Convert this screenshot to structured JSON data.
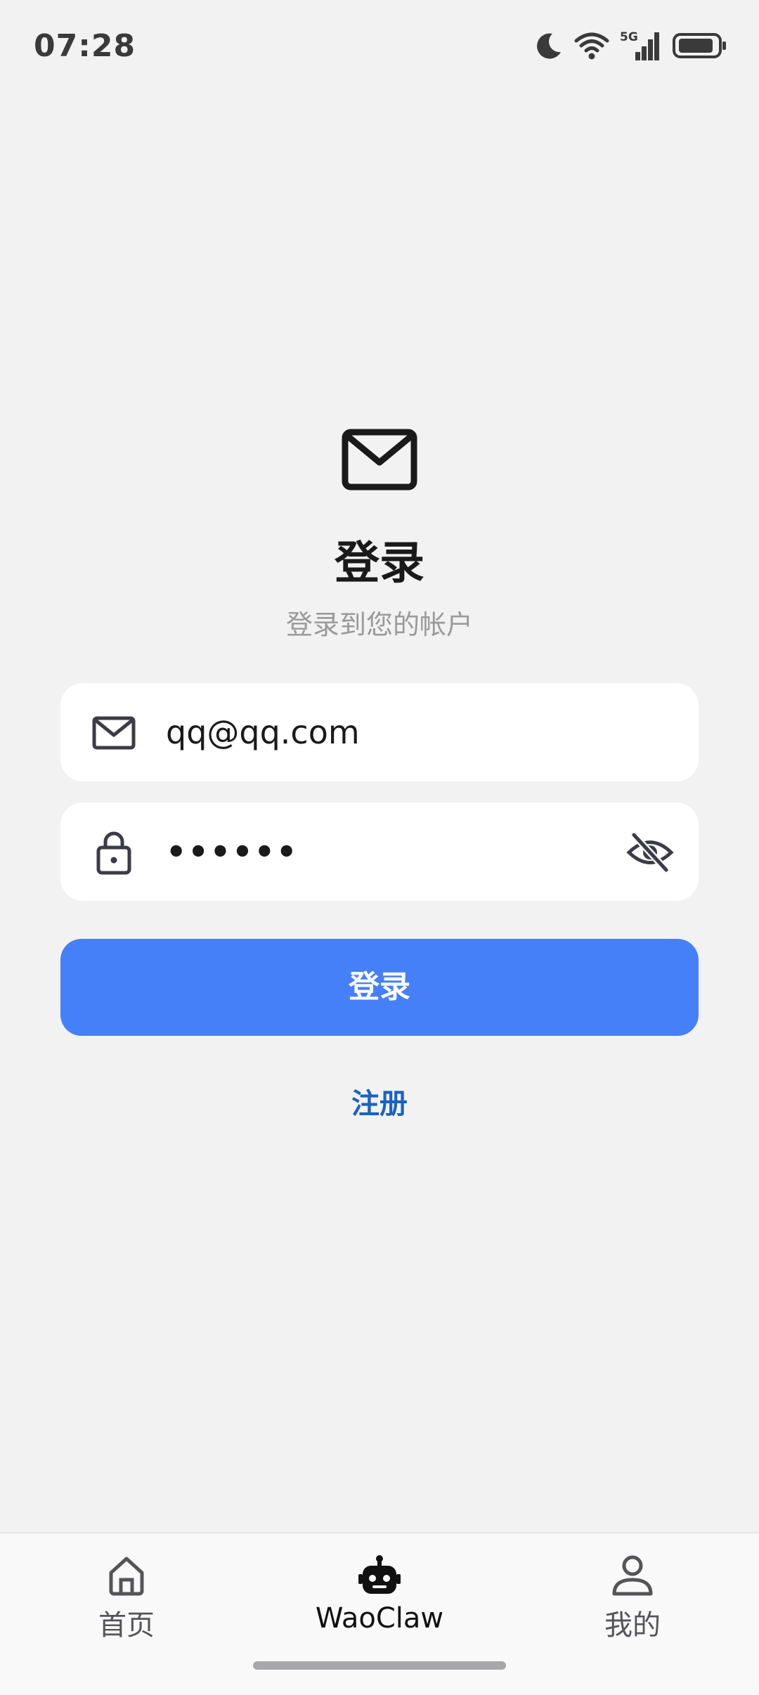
{
  "status_bar": {
    "time": "07:28",
    "icons": [
      "moon-icon",
      "wifi-icon",
      "5g-signal-icon",
      "battery-icon"
    ],
    "network_label": "5G"
  },
  "header": {
    "icon": "mail-icon",
    "title": "登录",
    "subtitle": "登录到您的帐户"
  },
  "form": {
    "email": {
      "icon": "mail-outline-icon",
      "value": "qq@qq.com"
    },
    "password": {
      "icon": "lock-icon",
      "masked_value": "••••••",
      "toggle_icon": "eye-off-icon"
    },
    "login_label": "登录",
    "register_label": "注册"
  },
  "bottom_nav": {
    "items": [
      {
        "label": "首页",
        "icon": "home-icon"
      },
      {
        "label": "WaoClaw",
        "icon": "robot-icon"
      },
      {
        "label": "我的",
        "icon": "person-icon"
      }
    ],
    "active_index": 1
  },
  "colors": {
    "background": "#f2f2f3",
    "primary": "#4680f8",
    "link": "#1a62c0",
    "subtitle": "#9a9a9a"
  }
}
